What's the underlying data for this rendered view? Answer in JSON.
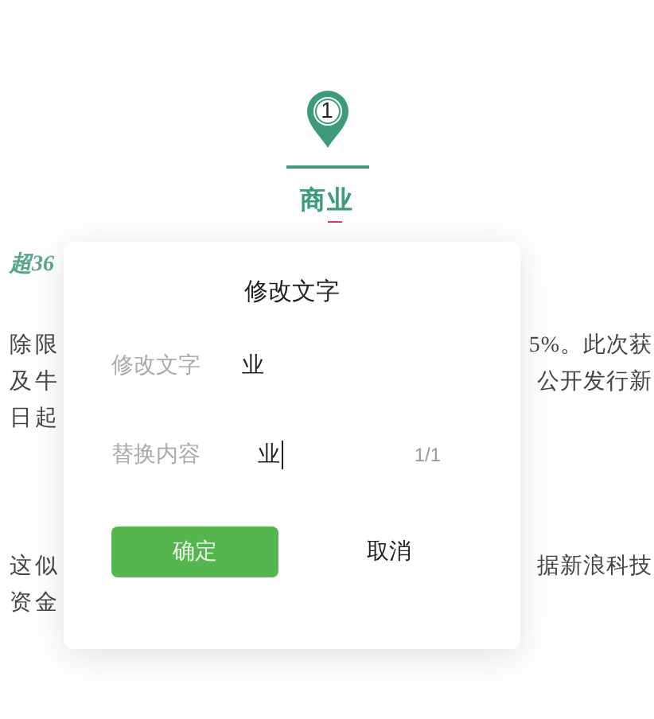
{
  "header": {
    "step": "1",
    "title": "商业"
  },
  "article": {
    "heading": "超36",
    "paragraphs": [
      {
        "lines": [
          {
            "left": "除限",
            "right": "5%。此次获"
          },
          {
            "left": "及牛",
            "right": "公开发行新"
          },
          {
            "left": "日起"
          }
        ]
      },
      {
        "lines": [
          {
            "left": "这似",
            "right": "据新浪科技"
          },
          {
            "left": "资金"
          }
        ]
      }
    ]
  },
  "dialog": {
    "title": "修改文字",
    "fields": [
      {
        "label": "修改文字",
        "value": "业",
        "kind": "text"
      },
      {
        "label": "替换内容",
        "value": "业",
        "counter": "1/1",
        "kind": "input",
        "focused": true
      }
    ],
    "buttons": [
      {
        "label": "确定",
        "kind": "primary"
      },
      {
        "label": "取消",
        "kind": "plain"
      }
    ]
  }
}
